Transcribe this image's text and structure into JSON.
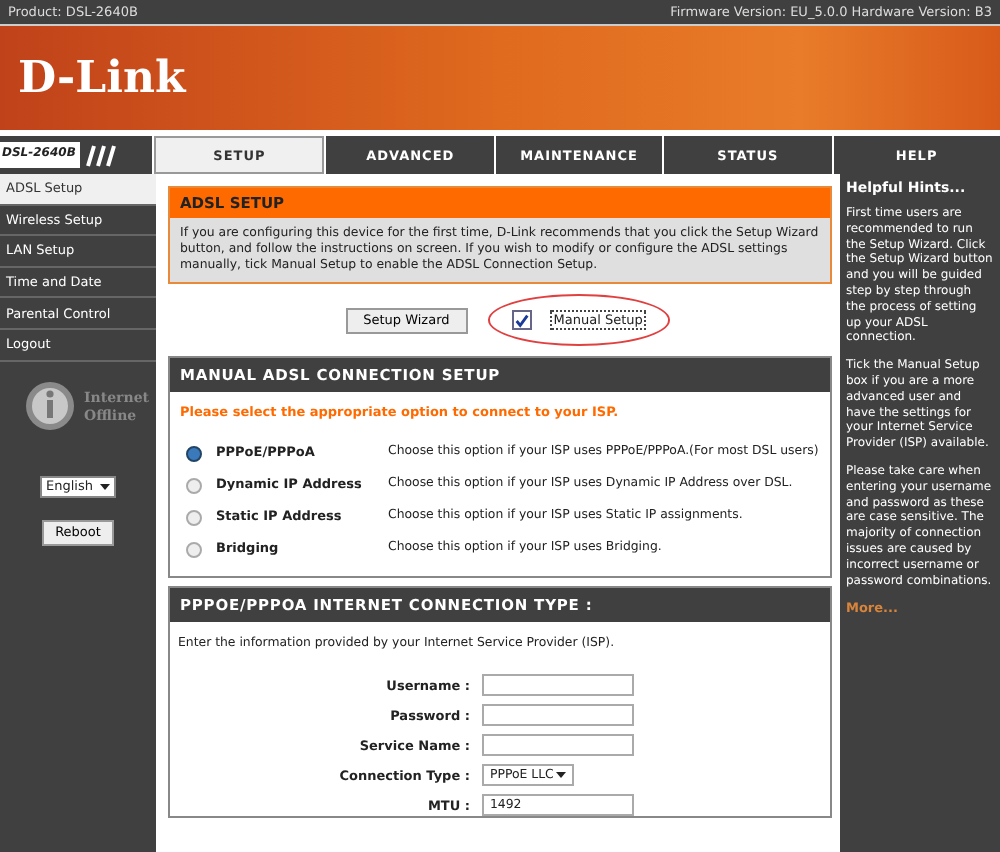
{
  "top_bar": {
    "product": "Product: DSL-2640B",
    "firmware": "Firmware Version: EU_5.0.0 Hardware Version: B3"
  },
  "banner": {
    "logo": "D-Link"
  },
  "model_label": "DSL-2640B",
  "tabs": [
    {
      "label": "SETUP",
      "selected": true
    },
    {
      "label": "ADVANCED",
      "selected": false
    },
    {
      "label": "MAINTENANCE",
      "selected": false
    },
    {
      "label": "STATUS",
      "selected": false
    },
    {
      "label": "HELP",
      "selected": false
    }
  ],
  "sidebar": {
    "items": [
      {
        "label": "ADSL Setup",
        "selected": true
      },
      {
        "label": "Wireless Setup",
        "selected": false
      },
      {
        "label": "LAN Setup",
        "selected": false
      },
      {
        "label": "Time and Date",
        "selected": false
      },
      {
        "label": "Parental Control",
        "selected": false
      },
      {
        "label": "Logout",
        "selected": false
      }
    ],
    "status_line_1": "Internet",
    "status_line_2": "Offline",
    "language": "English",
    "reboot": "Reboot"
  },
  "adsl_setup": {
    "title": "ADSL SETUP",
    "text": "If you are configuring this device for the first time, D-Link recommends that you click the Setup Wizard button, and follow the instructions on screen. If you wish to modify or configure the ADSL settings manually, tick Manual Setup to enable the ADSL Connection Setup.",
    "wizard_button": "Setup Wizard",
    "manual_setup": {
      "label": "Manual Setup",
      "checked": true
    }
  },
  "manual_setup": {
    "title": "MANUAL ADSL CONNECTION SETUP",
    "prompt": "Please select the appropriate option to connect to your ISP.",
    "options": [
      {
        "label": "PPPoE/PPPoA",
        "description": "Choose this option if your ISP uses PPPoE/PPPoA.(For most DSL users)",
        "selected": true
      },
      {
        "label": "Dynamic IP Address",
        "description": "Choose this option if your ISP uses Dynamic IP Address over DSL.",
        "selected": false
      },
      {
        "label": "Static IP Address",
        "description": "Choose this option if your ISP uses Static IP assignments.",
        "selected": false
      },
      {
        "label": "Bridging",
        "description": "Choose this option if your ISP uses Bridging.",
        "selected": false
      }
    ]
  },
  "pppoe": {
    "title": "PPPOE/PPPOA INTERNET CONNECTION TYPE :",
    "text": "Enter the information provided by your Internet Service Provider (ISP).",
    "fields": [
      {
        "label": "Username :",
        "kind": "text"
      },
      {
        "label": "Password :",
        "kind": "text"
      },
      {
        "label": "Service Name :",
        "kind": "text"
      },
      {
        "label": "Connection Type :",
        "kind": "select",
        "value": "PPPoE LLC"
      },
      {
        "label": "MTU :",
        "kind": "text",
        "value": "1492"
      }
    ]
  },
  "hints": {
    "title": "Helpful Hints...",
    "paragraphs": [
      "First time users are recommended to run the Setup Wizard. Click the Setup Wizard button and you will be guided step by step through the process of setting up your ADSL connection.",
      "Tick the Manual Setup box if you are a more advanced user and have the settings for your Internet Service Provider (ISP) available.",
      "Please take care when entering your username and password as these are case sensitive. The majority of connection issues are caused by incorrect username or password combinations."
    ],
    "more": "More..."
  }
}
